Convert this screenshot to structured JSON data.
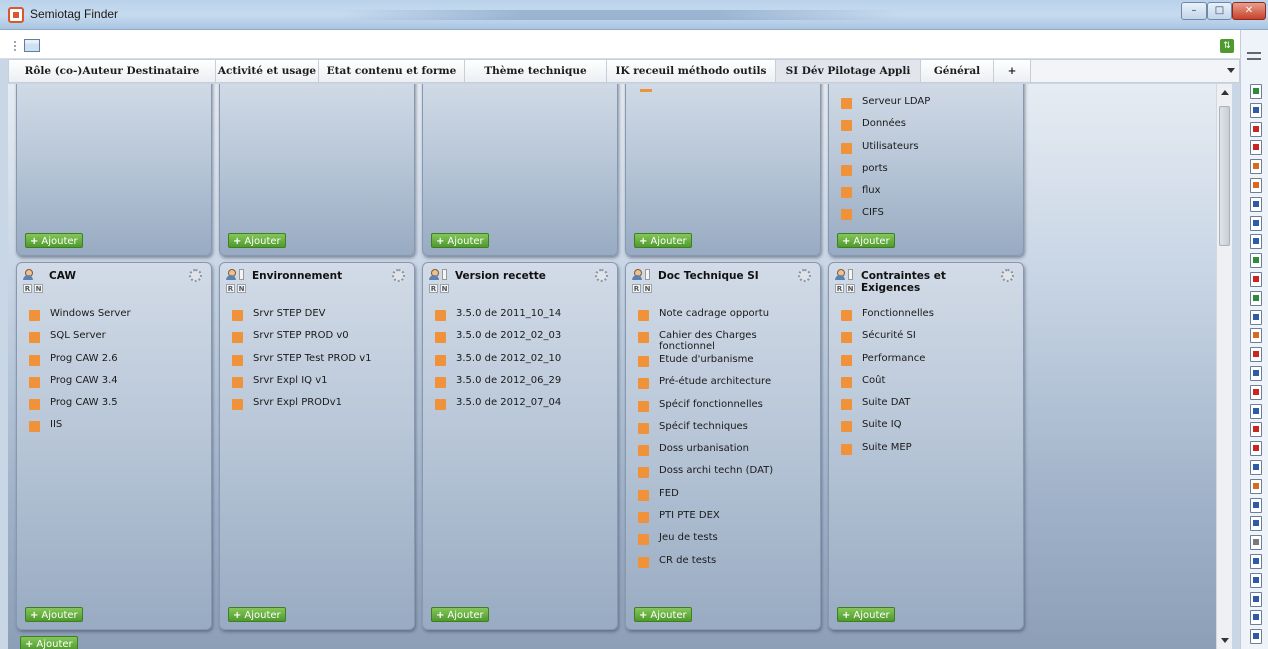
{
  "window": {
    "title": "Semiotag Finder",
    "controls": {
      "minimize": "–",
      "maximize": "□",
      "close": "✕"
    }
  },
  "tabs": [
    {
      "label": "Rôle (co-)Auteur Destinataire",
      "active": false
    },
    {
      "label": "Activité et usage",
      "active": false
    },
    {
      "label": "Etat contenu et forme",
      "active": false
    },
    {
      "label": "Thème technique",
      "active": false
    },
    {
      "label": "IK receuil méthodo outils",
      "active": false
    },
    {
      "label": "SI Dév Pilotage Appli",
      "active": true
    },
    {
      "label": "Général",
      "active": false
    },
    {
      "label": "+",
      "active": false
    }
  ],
  "add_label": "Ajouter",
  "badges": {
    "r": "R",
    "n": "N"
  },
  "top_panels": [
    {
      "items": []
    },
    {
      "items": []
    },
    {
      "items": []
    },
    {
      "items": []
    },
    {
      "items": [
        "Serveur LDAP",
        "Données",
        "Utilisateurs",
        "ports",
        "flux",
        "CIFS"
      ]
    }
  ],
  "bottom_panels": [
    {
      "title": "CAW",
      "items": [
        "Windows Server",
        "SQL Server",
        "Prog CAW 2.6",
        "Prog CAW 3.4",
        "Prog CAW 3.5",
        "IIS"
      ]
    },
    {
      "title": "Environnement",
      "items": [
        "Srvr STEP DEV",
        "Srvr STEP PROD v0",
        "Srvr STEP Test PROD v1",
        "Srvr Expl IQ v1",
        "Srvr Expl PRODv1"
      ]
    },
    {
      "title": "Version recette",
      "items": [
        "3.5.0 de 2011_10_14",
        "3.5.0 de 2012_02_03",
        "3.5.0 de 2012_02_10",
        "3.5.0 de 2012_06_29",
        "3.5.0 de 2012_07_04"
      ]
    },
    {
      "title": "Doc Technique SI",
      "items": [
        "Note cadrage opportu",
        "Cahier des Charges fonctionnel",
        "Etude d'urbanisme",
        "Pré-étude architecture",
        "Spécif fonctionnelles",
        "Spécif techniques",
        "Doss urbanisation",
        "Doss archi techn (DAT)",
        "FED",
        "PTI PTE DEX",
        "Jeu de tests",
        "CR de tests"
      ]
    },
    {
      "title": "Contraintes et Exigences",
      "items": [
        "Fonctionnelles",
        "Sécurité SI",
        "Performance",
        "Coût",
        "Suite DAT",
        "Suite IQ",
        "Suite MEP"
      ]
    }
  ],
  "file_icons": [
    "x",
    "w",
    "p",
    "p",
    "o",
    "o",
    "w",
    "w",
    "w",
    "x",
    "p",
    "x",
    "w",
    "o",
    "p",
    "w",
    "p",
    "w",
    "p",
    "p",
    "w",
    "o",
    "w",
    "w",
    "g",
    "w",
    "w",
    "w",
    "w",
    "w"
  ],
  "colors": {
    "accent_green": "#5aa534",
    "item_square": "#f0923a"
  }
}
